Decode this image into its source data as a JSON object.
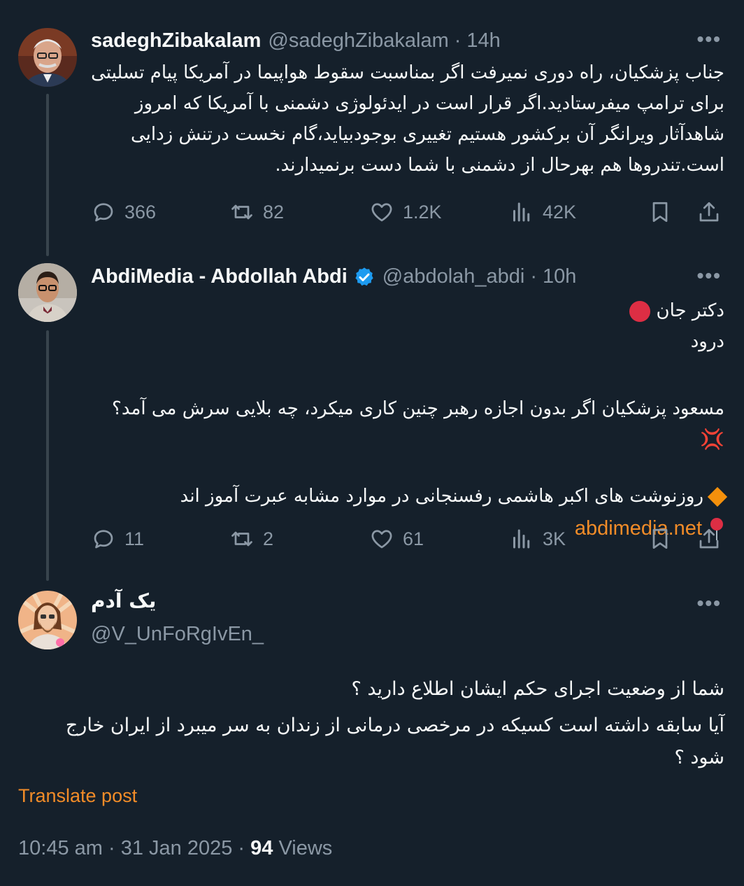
{
  "tweets": [
    {
      "name": "sadeghZibakalam",
      "handle": "@sadeghZibakalam",
      "time": "14h",
      "text_lines": [
        "جناب پزشکیان، راه دوری نمیرفت اگر بمناسبت سقوط هواپیما در آمریکا پیام تسلیتی",
        "برای ترامپ میفرستادید.اگر قرار است در ایدئولوژی دشمنی با آمریکا که امروز",
        "شاهدآثار ویرانگر آن برکشور هستیم تغییری بوجودبیاید،گام نخست درتنش زدایی",
        "است.تندروها هم بهرحال از دشمنی با شما دست برنمیدارند."
      ],
      "stats": {
        "replies": "366",
        "reposts": "82",
        "likes": "1.2K",
        "views": "42K"
      }
    },
    {
      "name": "AbdiMedia - Abdollah Abdi",
      "handle": "@abdolah_abdi",
      "time": "10h",
      "verified": true,
      "line1": "دکتر جان",
      "line2": "درود",
      "line3": "مسعود پزشکیان اگر بدون اجازه رهبر چنین کاری میکرد، چه بلایی سرش می آمد؟",
      "line4": "روزنوشت های اکبر هاشمی رفسنجانی در موارد مشابه عبرت آموز اند",
      "link": "abdimedia.net",
      "stats": {
        "replies": "11",
        "reposts": "2",
        "likes": "61",
        "views": "3K"
      }
    }
  ],
  "main_post": {
    "name": "یک آدم",
    "handle": "@V_UnFoRgIvEn_",
    "text_lines": [
      "شما از وضعیت اجرای حکم ایشان اطلاع دارید ؟",
      "آیا سابقه داشته است کسیکه در مرخصی درمانی از زندان به سر میبرد از ایران خارج",
      "شود ؟"
    ],
    "translate_label": "Translate post",
    "time": "10:45 am",
    "date": "31 Jan 2025",
    "views_count": "94",
    "views_label": "Views"
  },
  "colors": {
    "background": "#15202b",
    "muted": "#8b98a5",
    "accent": "#f28c28",
    "verified": "#1d9bf0"
  }
}
